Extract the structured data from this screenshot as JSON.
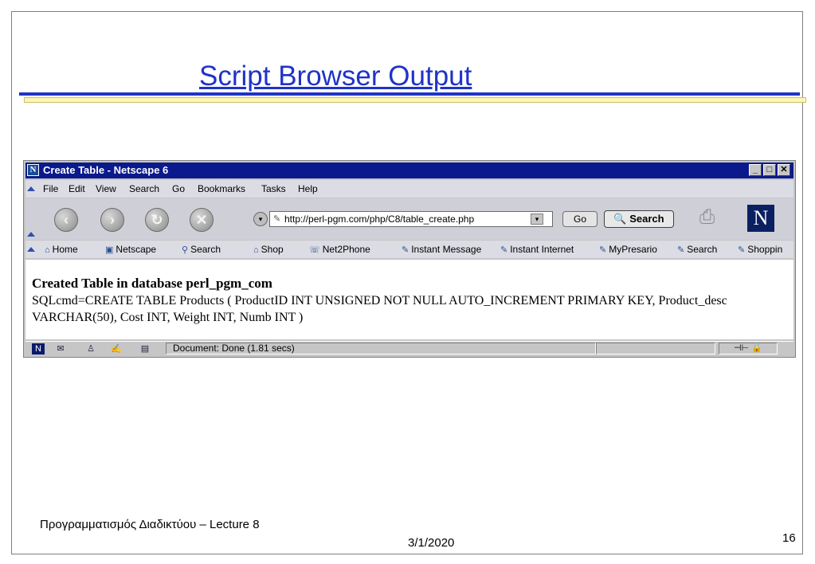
{
  "slide": {
    "title": "Script Browser Output",
    "footer_left": "Προγραμματισμός Διαδικτύου – Lecture 8",
    "footer_date": "3/1/2020",
    "page_number": "16",
    "title_color": "#1f33c7"
  },
  "browser": {
    "window_title": "Create Table - Netscape 6",
    "window_buttons": [
      "_",
      "□",
      "✕"
    ],
    "menu": [
      "File",
      "Edit",
      "View",
      "Search",
      "Go",
      "Bookmarks",
      "Tasks",
      "Help"
    ],
    "nav_icons": [
      "back-icon",
      "forward-icon",
      "reload-icon",
      "stop-icon"
    ],
    "url": "http://perl-pgm.com/php/C8/table_create.php",
    "go_label": "Go",
    "search_label": "Search",
    "personal_toolbar": [
      "Home",
      "Netscape",
      "Search",
      "Shop",
      "Net2Phone",
      "Instant Message",
      "Instant Internet",
      "MyPresario",
      "Search",
      "Shoppin"
    ],
    "content": {
      "heading": "Created Table in database perl_pgm_com",
      "sqlcmd": "SQLcmd=CREATE TABLE Products ( ProductID INT UNSIGNED NOT NULL AUTO_INCREMENT PRIMARY KEY, Product_desc VARCHAR(50), Cost INT, Weight INT, Numb INT )"
    },
    "status": "Document: Done (1.81 secs)",
    "titlebar_color": "#0a1a8c"
  }
}
